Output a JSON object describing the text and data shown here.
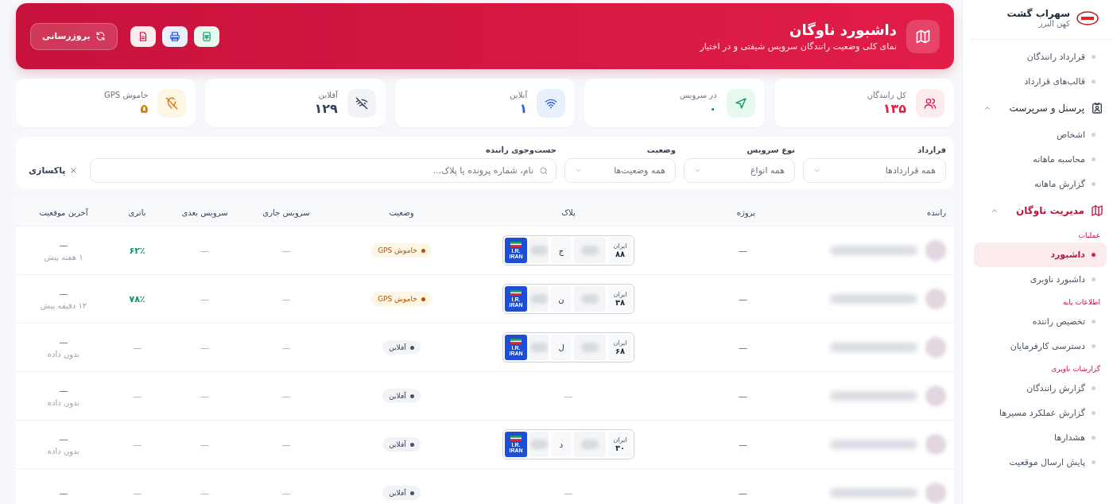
{
  "header": {
    "title": "داشبورد ناوگان",
    "subtitle": "نمای کلی وضعیت رانندگان سرویس شیفتی و در اختیار",
    "refresh_label": "بروزرسانی",
    "buttons": [
      {
        "kind": "excel"
      },
      {
        "kind": "print"
      },
      {
        "kind": "pdf"
      }
    ]
  },
  "stats": [
    {
      "kind": "drivers",
      "label": "کل رانندگان",
      "value": "۱۳۵",
      "color": "#e11d48"
    },
    {
      "kind": "service",
      "label": "در سرویس",
      "value": "۰",
      "color": "#059669"
    },
    {
      "kind": "online",
      "label": "آنلاین",
      "value": "۱",
      "color": "#2563eb"
    },
    {
      "kind": "offline",
      "label": "آفلاین",
      "value": "۱۲۹",
      "color": "#334155"
    },
    {
      "kind": "gps_off",
      "label": "خاموش GPS",
      "value": "۵",
      "color": "#d97706"
    }
  ],
  "filters": {
    "selects": [
      {
        "label": "قرارداد",
        "placeholder": "همه قراردادها"
      },
      {
        "label": "نوع سرویس",
        "placeholder": "همه انواع"
      },
      {
        "label": "وضعیت",
        "placeholder": "همه وضعیت‌ها"
      }
    ],
    "search": {
      "label": "جست‌وجوی راننده",
      "placeholder": "نام، شماره پرونده یا پلاک..."
    },
    "clear_label": "پاکسازی"
  },
  "table": {
    "columns": [
      "راننده",
      "پروژه",
      "پلاک",
      "وضعیت",
      "سرویس جاری",
      "سرویس بعدی",
      "باتری",
      "آخرین موقعیت"
    ],
    "rows": [
      {
        "project": "—",
        "plate": {
          "letter": "ج",
          "country": "ایران",
          "region": "۸۸",
          "flag_text": "I.R. IRAN"
        },
        "status": {
          "kind": "gps_off",
          "label": "خاموش GPS"
        },
        "current_service": "—",
        "next_service": "—",
        "battery": "۶۲٪",
        "location": "—",
        "last_seen": "۱ هفته پیش"
      },
      {
        "project": "—",
        "plate": {
          "letter": "ن",
          "country": "ایران",
          "region": "۳۸",
          "flag_text": "I.R. IRAN"
        },
        "status": {
          "kind": "gps_off",
          "label": "خاموش GPS"
        },
        "current_service": "—",
        "next_service": "—",
        "battery": "۷۸٪",
        "location": "—",
        "last_seen": "۱۲ دقیقه پیش"
      },
      {
        "project": "—",
        "plate": {
          "letter": "ل",
          "country": "ایران",
          "region": "۶۸",
          "flag_text": "I.R. IRAN"
        },
        "status": {
          "kind": "offline",
          "label": "آفلاین"
        },
        "current_service": "—",
        "next_service": "—",
        "battery": "—",
        "location": "—",
        "last_seen": "بدون داده"
      },
      {
        "project": "—",
        "plate_text": "—",
        "status": {
          "kind": "offline",
          "label": "آفلاین"
        },
        "current_service": "—",
        "next_service": "—",
        "battery": "—",
        "location": "—",
        "last_seen": "بدون داده"
      },
      {
        "project": "—",
        "plate": {
          "letter": "د",
          "country": "ایران",
          "region": "۳۰",
          "flag_text": "I.R. IRAN"
        },
        "status": {
          "kind": "offline",
          "label": "آفلاین"
        },
        "current_service": "—",
        "next_service": "—",
        "battery": "—",
        "location": "—",
        "last_seen": "بدون داده"
      },
      {
        "project": "—",
        "plate_text": "—",
        "status": {
          "kind": "offline",
          "label": "آفلاین"
        },
        "current_service": "—",
        "next_service": "—",
        "battery": "—",
        "location": "—"
      }
    ]
  },
  "sidebar": {
    "brand": "سهراب گشت",
    "subtitle": "کهن البرز",
    "items": [
      {
        "kind": "link",
        "label": "قرارداد رانندگان",
        "selected": false
      },
      {
        "kind": "link",
        "label": "قالب‌های قرارداد",
        "selected": false
      },
      {
        "kind": "group",
        "label": "پرسنل و سرپرست",
        "expanded": true,
        "active": false,
        "children": [
          {
            "kind": "link",
            "label": "اشخاص",
            "selected": false
          },
          {
            "kind": "link",
            "label": "محاسبه ماهانه",
            "selected": false
          },
          {
            "kind": "link",
            "label": "گزارش ماهانه",
            "selected": false
          }
        ]
      },
      {
        "kind": "group",
        "label": "مدیریت ناوگان",
        "expanded": true,
        "active": true,
        "children": [
          {
            "kind": "heading",
            "label": "عملیات"
          },
          {
            "kind": "link",
            "label": "داشبورد",
            "selected": true
          },
          {
            "kind": "link",
            "label": "داشبورد ناوبری",
            "selected": false
          },
          {
            "kind": "heading",
            "label": "اطلاعات پایه"
          },
          {
            "kind": "link",
            "label": "تخصیص راننده",
            "selected": false
          },
          {
            "kind": "link",
            "label": "دسترسی کارفرمایان",
            "selected": false
          },
          {
            "kind": "heading",
            "label": "گزارشات ناوبری"
          },
          {
            "kind": "link",
            "label": "گزارش رانندگان",
            "selected": false
          },
          {
            "kind": "link",
            "label": "گزارش عملکرد مسیرها",
            "selected": false
          },
          {
            "kind": "link",
            "label": "هشدارها",
            "selected": false
          },
          {
            "kind": "link",
            "label": "پایش ارسال موقعیت",
            "selected": false
          }
        ]
      }
    ]
  }
}
